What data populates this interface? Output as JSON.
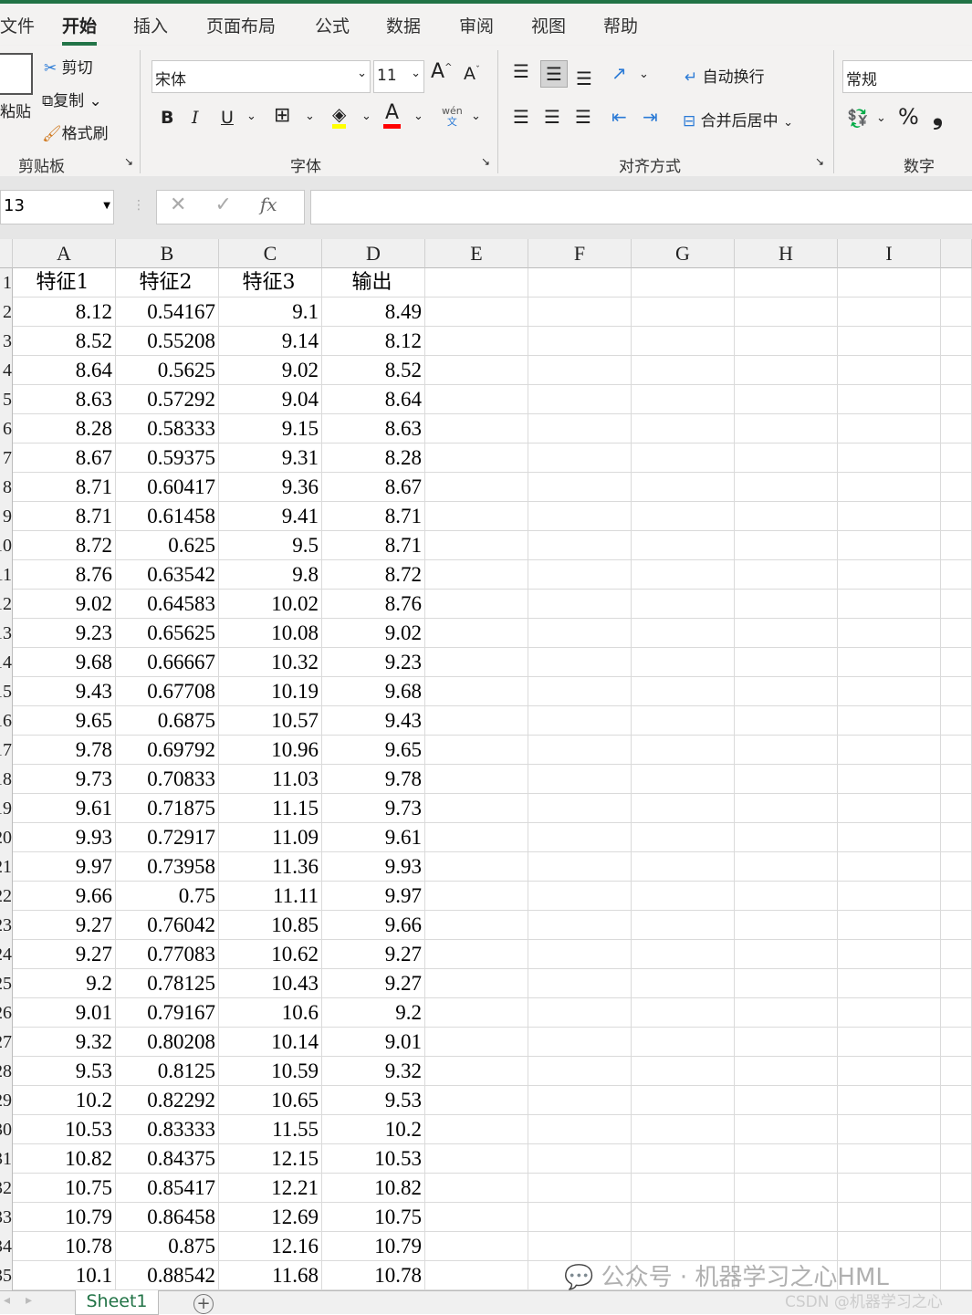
{
  "tabs": [
    "文件",
    "开始",
    "插入",
    "页面布局",
    "公式",
    "数据",
    "审阅",
    "视图",
    "帮助"
  ],
  "active_tab": "开始",
  "ribbon": {
    "clipboard": {
      "paste": "粘贴",
      "cut": "剪切",
      "copy": "复制",
      "format_painter": "格式刷",
      "group": "剪贴板"
    },
    "font": {
      "name": "宋体",
      "size": "11",
      "bold": "B",
      "italic": "I",
      "underline": "U",
      "font_color_letter": "A",
      "phonetic": "wén",
      "phonetic_char": "文",
      "group": "字体",
      "highlight_color": "#ffff00",
      "font_color": "#ff0000"
    },
    "alignment": {
      "wrap": "自动换行",
      "merge": "合并后居中",
      "group": "对齐方式"
    },
    "number": {
      "format": "常规",
      "percent": "%",
      "comma": "❟",
      "group": "数字"
    }
  },
  "formula_bar": {
    "name_box": "13",
    "fx": "fx",
    "cancel": "✕",
    "enter": "✓",
    "value": ""
  },
  "columns": [
    "A",
    "B",
    "C",
    "D",
    "E",
    "F",
    "G",
    "H",
    "I"
  ],
  "headers": [
    "特征1",
    "特征2",
    "特征3",
    "输出"
  ],
  "rows": [
    [
      "8.12",
      "0.54167",
      "9.1",
      "8.49"
    ],
    [
      "8.52",
      "0.55208",
      "9.14",
      "8.12"
    ],
    [
      "8.64",
      "0.5625",
      "9.02",
      "8.52"
    ],
    [
      "8.63",
      "0.57292",
      "9.04",
      "8.64"
    ],
    [
      "8.28",
      "0.58333",
      "9.15",
      "8.63"
    ],
    [
      "8.67",
      "0.59375",
      "9.31",
      "8.28"
    ],
    [
      "8.71",
      "0.60417",
      "9.36",
      "8.67"
    ],
    [
      "8.71",
      "0.61458",
      "9.41",
      "8.71"
    ],
    [
      "8.72",
      "0.625",
      "9.5",
      "8.71"
    ],
    [
      "8.76",
      "0.63542",
      "9.8",
      "8.72"
    ],
    [
      "9.02",
      "0.64583",
      "10.02",
      "8.76"
    ],
    [
      "9.23",
      "0.65625",
      "10.08",
      "9.02"
    ],
    [
      "9.68",
      "0.66667",
      "10.32",
      "9.23"
    ],
    [
      "9.43",
      "0.67708",
      "10.19",
      "9.68"
    ],
    [
      "9.65",
      "0.6875",
      "10.57",
      "9.43"
    ],
    [
      "9.78",
      "0.69792",
      "10.96",
      "9.65"
    ],
    [
      "9.73",
      "0.70833",
      "11.03",
      "9.78"
    ],
    [
      "9.61",
      "0.71875",
      "11.15",
      "9.73"
    ],
    [
      "9.93",
      "0.72917",
      "11.09",
      "9.61"
    ],
    [
      "9.97",
      "0.73958",
      "11.36",
      "9.93"
    ],
    [
      "9.66",
      "0.75",
      "11.11",
      "9.97"
    ],
    [
      "9.27",
      "0.76042",
      "10.85",
      "9.66"
    ],
    [
      "9.27",
      "0.77083",
      "10.62",
      "9.27"
    ],
    [
      "9.2",
      "0.78125",
      "10.43",
      "9.27"
    ],
    [
      "9.01",
      "0.79167",
      "10.6",
      "9.2"
    ],
    [
      "9.32",
      "0.80208",
      "10.14",
      "9.01"
    ],
    [
      "9.53",
      "0.8125",
      "10.59",
      "9.32"
    ],
    [
      "10.2",
      "0.82292",
      "10.65",
      "9.53"
    ],
    [
      "10.53",
      "0.83333",
      "11.55",
      "10.2"
    ],
    [
      "10.82",
      "0.84375",
      "12.15",
      "10.53"
    ],
    [
      "10.75",
      "0.85417",
      "12.21",
      "10.82"
    ],
    [
      "10.79",
      "0.86458",
      "12.69",
      "10.75"
    ],
    [
      "10.78",
      "0.875",
      "12.16",
      "10.79"
    ],
    [
      "10.1",
      "0.88542",
      "11.68",
      "10.78"
    ]
  ],
  "sheet_tab": "Sheet1",
  "add_sheet": "+",
  "watermark": {
    "wechat": "公众号 · 机器学习之心HML",
    "csdn": "CSDN @机器学习之心"
  }
}
